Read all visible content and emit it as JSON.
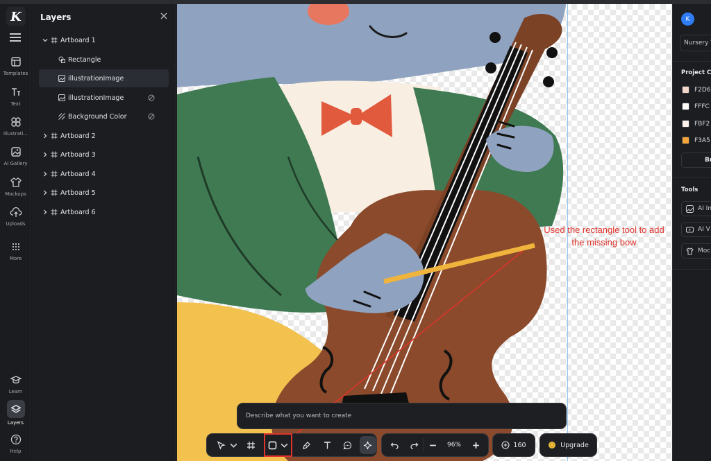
{
  "rail": {
    "logo": "K",
    "items": [
      {
        "label": "Templates",
        "icon": "templates-icon"
      },
      {
        "label": "Text",
        "icon": "text-icon"
      },
      {
        "label": "Illustrati...",
        "icon": "illustrations-icon"
      },
      {
        "label": "AI Gallery",
        "icon": "ai-gallery-icon"
      },
      {
        "label": "Mockups",
        "icon": "mockups-icon"
      },
      {
        "label": "Uploads",
        "icon": "uploads-icon"
      },
      {
        "label": "More",
        "icon": "more-icon"
      }
    ],
    "bottom": [
      {
        "label": "Learn",
        "icon": "learn-icon"
      },
      {
        "label": "Layers",
        "icon": "layers-icon"
      },
      {
        "label": "Help",
        "icon": "help-icon"
      }
    ]
  },
  "layers": {
    "title": "Layers",
    "rows": [
      {
        "label": "Artboard 1",
        "type": "artboard",
        "expanded": true
      },
      {
        "label": "Rectangle",
        "type": "shape"
      },
      {
        "label": "illustrationImage",
        "type": "image",
        "selected": true
      },
      {
        "label": "illustrationImage",
        "type": "image",
        "hidden": true
      },
      {
        "label": "Background Color",
        "type": "background",
        "hidden": true
      },
      {
        "label": "Artboard 2",
        "type": "artboard"
      },
      {
        "label": "Artboard 3",
        "type": "artboard"
      },
      {
        "label": "Artboard 4",
        "type": "artboard"
      },
      {
        "label": "Artboard 5",
        "type": "artboard"
      },
      {
        "label": "Artboard 6",
        "type": "artboard"
      }
    ]
  },
  "canvas": {
    "annotation": "Used the rectangle tool to add the missing bow",
    "colors": {
      "elephant": "#8fa2bf",
      "jacket": "#3f7a52",
      "bowtie": "#e25a3e",
      "cello": "#8a4a2b",
      "bow": "#f0b43c",
      "pants": "#f2c14e",
      "annotation": "#e0342c"
    }
  },
  "right_panel": {
    "avatar": "K",
    "project_name": "Nursery V",
    "project_colors_title": "Project Co",
    "colors": [
      {
        "hex": "#F2D6C9",
        "label": "F2D6"
      },
      {
        "hex": "#FFFCF7",
        "label": "FFFC"
      },
      {
        "hex": "#FBF2EC",
        "label": "FBF2"
      },
      {
        "hex": "#F3A53A",
        "label": "F3A5"
      }
    ],
    "brand_button": "Br",
    "tools_title": "Tools",
    "tools": [
      {
        "label": "AI Im",
        "icon": "ai-image-icon"
      },
      {
        "label": "AI V",
        "icon": "ai-video-icon"
      },
      {
        "label": "Moc",
        "icon": "mockup-icon"
      }
    ]
  },
  "prompt": {
    "placeholder": "Describe what you want to create"
  },
  "toolbar": {
    "zoom": "96%",
    "credits": "160",
    "upgrade": "Upgrade"
  }
}
